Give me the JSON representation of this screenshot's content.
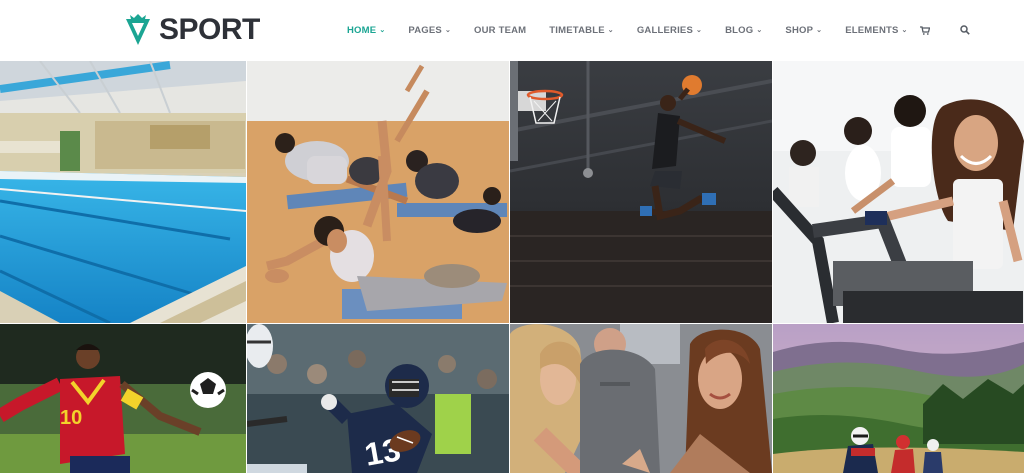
{
  "brand": {
    "name": "SPORT",
    "accent": "#1ba593"
  },
  "nav": {
    "items": [
      {
        "label": "HOME",
        "has_dropdown": true,
        "active": true
      },
      {
        "label": "PAGES",
        "has_dropdown": true,
        "active": false
      },
      {
        "label": "OUR TEAM",
        "has_dropdown": false,
        "active": false
      },
      {
        "label": "TIMETABLE",
        "has_dropdown": true,
        "active": false
      },
      {
        "label": "GALLERIES",
        "has_dropdown": true,
        "active": false
      },
      {
        "label": "BLOG",
        "has_dropdown": true,
        "active": false
      },
      {
        "label": "SHOP",
        "has_dropdown": true,
        "active": false
      },
      {
        "label": "ELEMENTS",
        "has_dropdown": true,
        "active": false
      }
    ],
    "icons": [
      "cart-icon",
      "search-icon"
    ]
  },
  "gallery": {
    "tiles": [
      {
        "name": "swimming-pool-photo"
      },
      {
        "name": "yoga-class-photo"
      },
      {
        "name": "basketball-dunk-photo"
      },
      {
        "name": "gym-cycling-photo"
      },
      {
        "name": "soccer-player-photo"
      },
      {
        "name": "american-football-photo"
      },
      {
        "name": "boxing-faceoff-photo"
      },
      {
        "name": "mountain-biking-photo"
      }
    ]
  }
}
